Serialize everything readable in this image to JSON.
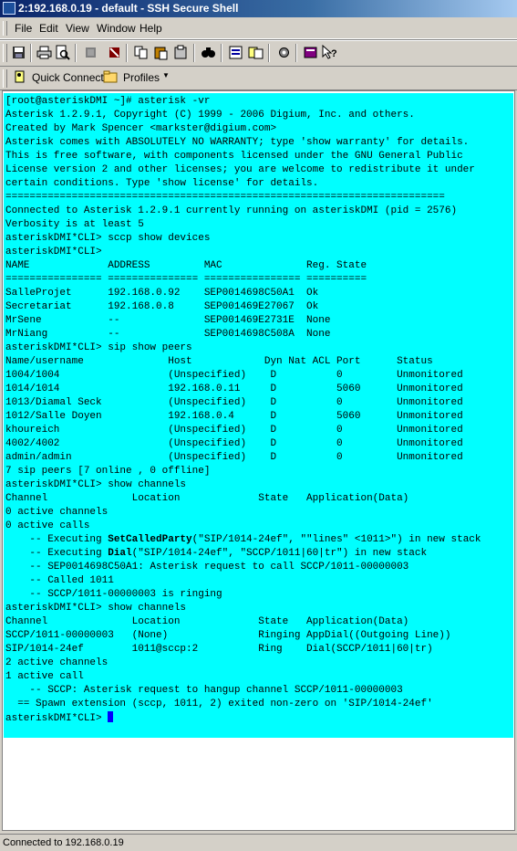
{
  "window": {
    "title": "2:192.168.0.19 - default - SSH Secure Shell"
  },
  "menu": [
    "File",
    "Edit",
    "View",
    "Window",
    "Help"
  ],
  "toolbar": {
    "icons": [
      "save-icon",
      "print-icon",
      "print-preview-icon",
      "disconnect-icon",
      "delete-icon",
      "copy-icon",
      "paste-icon",
      "paste-special-icon",
      "find-icon",
      "settings-icon",
      "file-transfer-icon",
      "gear-icon",
      "help-book-icon",
      "help-pointer-icon"
    ]
  },
  "quickbar": {
    "quick_connect": "Quick Connect",
    "profiles": "Profiles"
  },
  "console": {
    "lines": [
      "[root@asteriskDMI ~]# asterisk -vr",
      "Asterisk 1.2.9.1, Copyright (C) 1999 - 2006 Digium, Inc. and others.",
      "Created by Mark Spencer <markster@digium.com>",
      "Asterisk comes with ABSOLUTELY NO WARRANTY; type 'show warranty' for details.",
      "This is free software, with components licensed under the GNU General Public",
      "License version 2 and other licenses; you are welcome to redistribute it under",
      "certain conditions. Type 'show license' for details.",
      "=========================================================================",
      "Connected to Asterisk 1.2.9.1 currently running on asteriskDMI (pid = 2576)",
      "Verbosity is at least 5",
      "asteriskDMI*CLI> sccp show devices",
      "asteriskDMI*CLI>",
      "NAME             ADDRESS         MAC              Reg. State",
      "================ =============== ================ ==========",
      "SalleProjet      192.168.0.92    SEP0014698C50A1  Ok",
      "Secretariat      192.168.0.8     SEP001469E27067  Ok",
      "MrSene           --              SEP001469E2731E  None",
      "MrNiang          --              SEP0014698C508A  None",
      "asteriskDMI*CLI> sip show peers",
      "Name/username              Host            Dyn Nat ACL Port      Status",
      "1004/1004                  (Unspecified)    D          0         Unmonitored",
      "1014/1014                  192.168.0.11     D          5060      Unmonitored",
      "1013/Diamal Seck           (Unspecified)    D          0         Unmonitored",
      "1012/Salle Doyen           192.168.0.4      D          5060      Unmonitored",
      "khoureich                  (Unspecified)    D          0         Unmonitored",
      "4002/4002                  (Unspecified)    D          0         Unmonitored",
      "admin/admin                (Unspecified)    D          0         Unmonitored",
      "7 sip peers [7 online , 0 offline]",
      "asteriskDMI*CLI> show channels",
      "Channel              Location             State   Application(Data)",
      "0 active channels",
      "0 active calls",
      "    -- Executing SetCalledParty(\"SIP/1014-24ef\", \"\"lines\" <1011>\") in new stack",
      "    -- Executing Dial(\"SIP/1014-24ef\", \"SCCP/1011|60|tr\") in new stack",
      "    -- SEP0014698C50A1: Asterisk request to call SCCP/1011-00000003",
      "    -- Called 1011",
      "    -- SCCP/1011-00000003 is ringing",
      "asteriskDMI*CLI> show channels",
      "Channel              Location             State   Application(Data)",
      "SCCP/1011-00000003   (None)               Ringing AppDial((Outgoing Line))",
      "SIP/1014-24ef        1011@sccp:2          Ring    Dial(SCCP/1011|60|tr)",
      "2 active channels",
      "1 active call",
      "    -- SCCP: Asterisk request to hangup channel SCCP/1011-00000003",
      "  == Spawn extension (sccp, 1011, 2) exited non-zero on 'SIP/1014-24ef'",
      "asteriskDMI*CLI> "
    ]
  },
  "status": {
    "text": "Connected to 192.168.0.19"
  },
  "colors": {
    "console_bg": "#00ffff",
    "cursor": "#0000ff",
    "title_bg": "#0a246a"
  }
}
